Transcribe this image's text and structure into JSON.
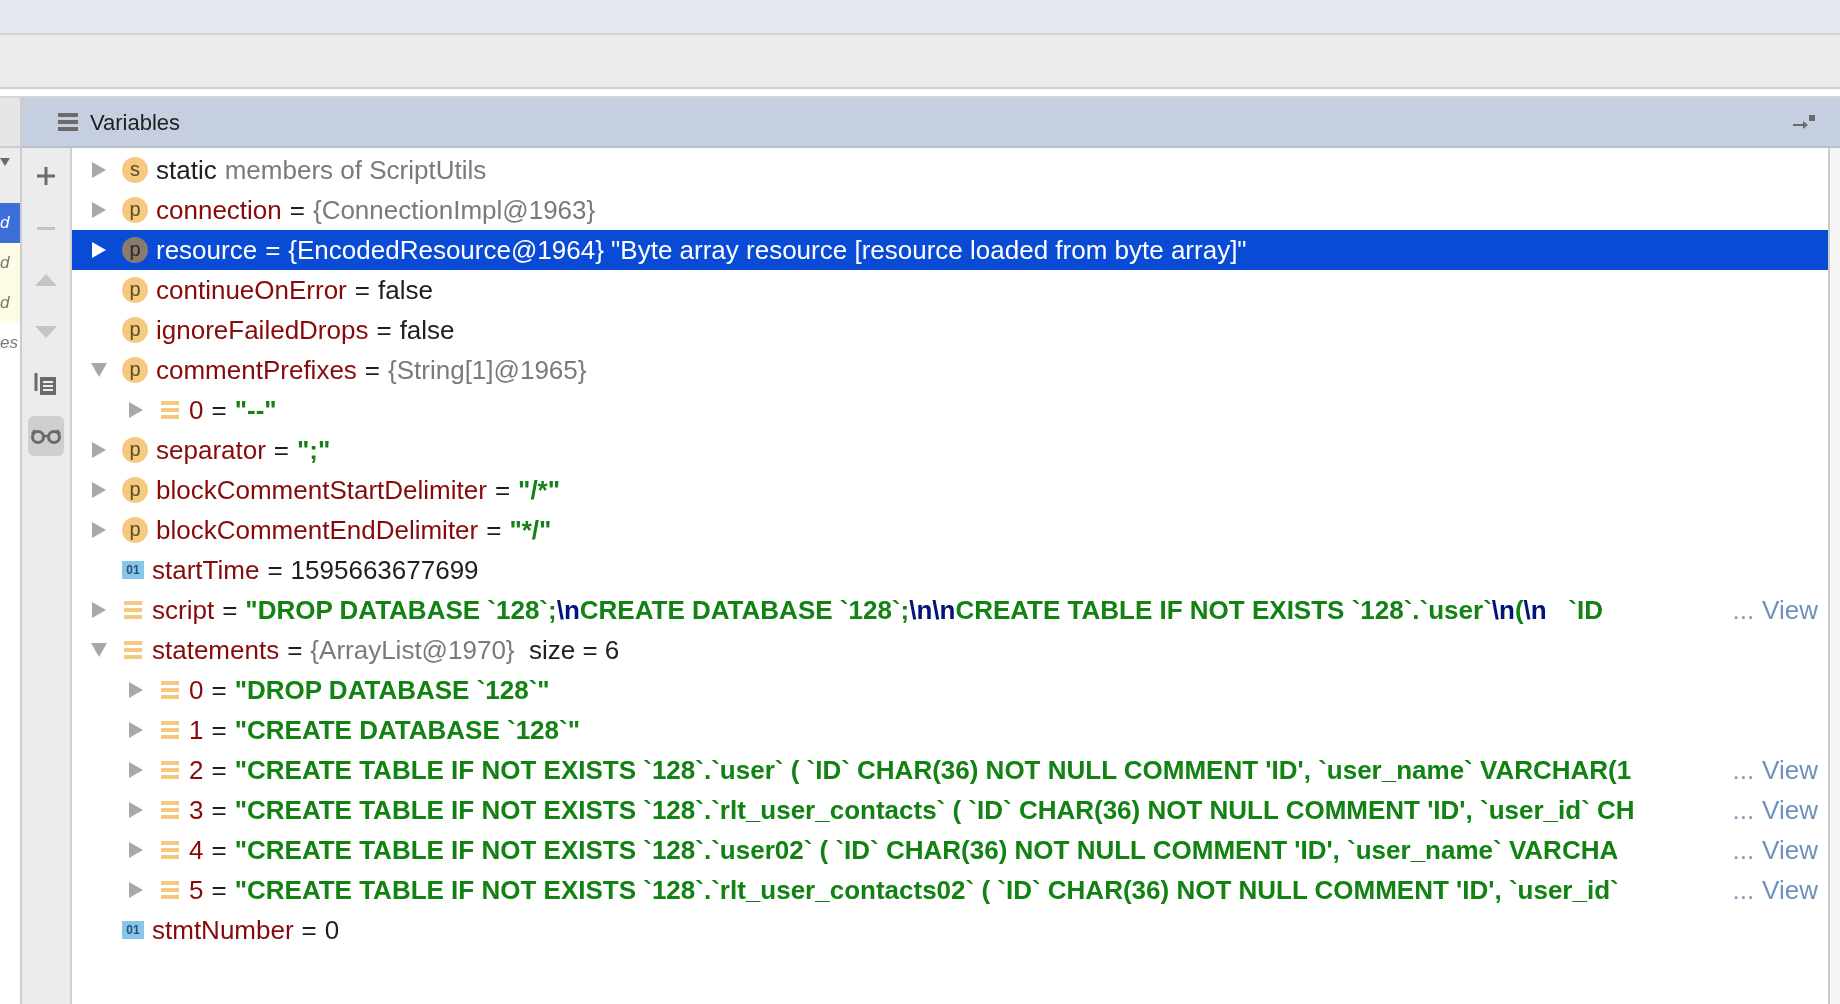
{
  "left_panel": {
    "items": [
      {
        "text": "d",
        "selected": true
      },
      {
        "text": "d",
        "selected": false,
        "highlight": true
      },
      {
        "text": "d",
        "selected": false,
        "highlight": true
      },
      {
        "text": "es",
        "selected": false
      }
    ]
  },
  "side_toolbar": [
    {
      "kind": "add",
      "disabled": false,
      "pressed": false
    },
    {
      "kind": "remove",
      "disabled": true,
      "pressed": false
    },
    {
      "kind": "up",
      "disabled": true,
      "pressed": false
    },
    {
      "kind": "down",
      "disabled": true,
      "pressed": false
    },
    {
      "kind": "copy",
      "disabled": false,
      "pressed": false
    },
    {
      "kind": "watch",
      "disabled": false,
      "pressed": true
    }
  ],
  "panel": {
    "title": "Variables"
  },
  "variables": [
    {
      "kind": "static",
      "badge": "s",
      "expandable": true,
      "expanded": false,
      "selected": false,
      "name": "static",
      "value": [
        {
          "kind": "object",
          "text": "members of ScriptUtils"
        }
      ]
    },
    {
      "kind": "field",
      "badge": "p",
      "expandable": true,
      "expanded": false,
      "selected": false,
      "name": "connection",
      "operator": "=",
      "value": [
        {
          "kind": "object",
          "text": "{ConnectionImpl@1963}"
        }
      ]
    },
    {
      "kind": "field",
      "badge": "p",
      "expandable": true,
      "expanded": false,
      "selected": true,
      "name": "resource",
      "operator": "=",
      "value": [
        {
          "kind": "object",
          "text": "{EncodedResource@1964}"
        },
        {
          "kind": "plain",
          "text": "\"Byte array resource [resource loaded from byte array]\""
        }
      ]
    },
    {
      "kind": "field",
      "badge": "p",
      "expandable": false,
      "selected": false,
      "name": "continueOnError",
      "operator": "=",
      "value": [
        {
          "kind": "plain",
          "text": "false"
        }
      ]
    },
    {
      "kind": "field",
      "badge": "p",
      "expandable": false,
      "selected": false,
      "name": "ignoreFailedDrops",
      "operator": "=",
      "value": [
        {
          "kind": "plain",
          "text": "false"
        }
      ]
    },
    {
      "kind": "field",
      "badge": "p",
      "expandable": true,
      "expanded": true,
      "selected": false,
      "name": "commentPrefixes",
      "operator": "=",
      "value": [
        {
          "kind": "object",
          "text": "{String[1]@1965}"
        }
      ],
      "children": [
        {
          "kind": "array",
          "expandable": true,
          "expanded": false,
          "selected": false,
          "name": "0",
          "operator": "=",
          "value": [
            {
              "kind": "string",
              "text": "\"--\""
            }
          ]
        }
      ]
    },
    {
      "kind": "field",
      "badge": "p",
      "expandable": true,
      "expanded": false,
      "selected": false,
      "name": "separator",
      "operator": "=",
      "value": [
        {
          "kind": "string",
          "text": "\";\""
        }
      ]
    },
    {
      "kind": "field",
      "badge": "p",
      "expandable": true,
      "expanded": false,
      "selected": false,
      "name": "blockCommentStartDelimiter",
      "operator": "=",
      "value": [
        {
          "kind": "string",
          "text": "\"/*\""
        }
      ]
    },
    {
      "kind": "field",
      "badge": "p",
      "expandable": true,
      "expanded": false,
      "selected": false,
      "name": "blockCommentEndDelimiter",
      "operator": "=",
      "value": [
        {
          "kind": "string",
          "text": "\"*/\""
        }
      ]
    },
    {
      "kind": "primitive",
      "badge": "01",
      "expandable": false,
      "selected": false,
      "name": "startTime",
      "operator": "=",
      "value": [
        {
          "kind": "plain",
          "text": "1595663677699"
        }
      ]
    },
    {
      "kind": "array",
      "expandable": true,
      "expanded": false,
      "selected": false,
      "name": "script",
      "operator": "=",
      "value": [
        {
          "kind": "string",
          "text": "\"DROP DATABASE `128`;"
        },
        {
          "kind": "escape",
          "text": "\\n"
        },
        {
          "kind": "string",
          "text": "CREATE DATABASE `128`;"
        },
        {
          "kind": "escape",
          "text": "\\n\\n"
        },
        {
          "kind": "string",
          "text": "CREATE TABLE IF NOT EXISTS `128`.`user`"
        },
        {
          "kind": "escape",
          "text": "\\n"
        },
        {
          "kind": "string",
          "text": "("
        },
        {
          "kind": "escape",
          "text": "\\n"
        },
        {
          "kind": "string",
          "text": "   `ID"
        }
      ],
      "ellipsis": "...",
      "link": "View"
    },
    {
      "kind": "array",
      "expandable": true,
      "expanded": true,
      "selected": false,
      "name": "statements",
      "operator": "=",
      "value": [
        {
          "kind": "object",
          "text": "{ArrayList@1970}"
        },
        {
          "kind": "plain",
          "text": " size = 6"
        }
      ],
      "children": [
        {
          "kind": "array",
          "expandable": true,
          "expanded": false,
          "selected": false,
          "name": "0",
          "operator": "=",
          "value": [
            {
              "kind": "string",
              "text": "\"DROP DATABASE `128`\""
            }
          ]
        },
        {
          "kind": "array",
          "expandable": true,
          "expanded": false,
          "selected": false,
          "name": "1",
          "operator": "=",
          "value": [
            {
              "kind": "string",
              "text": "\"CREATE DATABASE `128`\""
            }
          ]
        },
        {
          "kind": "array",
          "expandable": true,
          "expanded": false,
          "selected": false,
          "name": "2",
          "operator": "=",
          "value": [
            {
              "kind": "string",
              "text": "\"CREATE TABLE IF NOT EXISTS `128`.`user` ( `ID` CHAR(36) NOT NULL COMMENT 'ID', `user_name` VARCHAR(1"
            }
          ],
          "ellipsis": "...",
          "link": "View"
        },
        {
          "kind": "array",
          "expandable": true,
          "expanded": false,
          "selected": false,
          "name": "3",
          "operator": "=",
          "value": [
            {
              "kind": "string",
              "text": "\"CREATE TABLE IF NOT EXISTS `128`.`rlt_user_contacts` ( `ID` CHAR(36) NOT NULL COMMENT 'ID', `user_id` CH"
            }
          ],
          "ellipsis": "...",
          "link": "View"
        },
        {
          "kind": "array",
          "expandable": true,
          "expanded": false,
          "selected": false,
          "name": "4",
          "operator": "=",
          "value": [
            {
              "kind": "string",
              "text": "\"CREATE TABLE IF NOT EXISTS `128`.`user02` ( `ID` CHAR(36) NOT NULL COMMENT 'ID', `user_name` VARCHA"
            }
          ],
          "ellipsis": "...",
          "link": "View"
        },
        {
          "kind": "array",
          "expandable": true,
          "expanded": false,
          "selected": false,
          "name": "5",
          "operator": "=",
          "value": [
            {
              "kind": "string",
              "text": "\"CREATE TABLE IF NOT EXISTS `128`.`rlt_user_contacts02` ( `ID` CHAR(36) NOT NULL COMMENT 'ID', `user_id`"
            }
          ],
          "ellipsis": "...",
          "link": "View"
        }
      ]
    },
    {
      "kind": "primitive",
      "badge": "01",
      "expandable": false,
      "selected": false,
      "name": "stmtNumber",
      "operator": "=",
      "value": [
        {
          "kind": "plain",
          "text": "0"
        }
      ]
    }
  ]
}
